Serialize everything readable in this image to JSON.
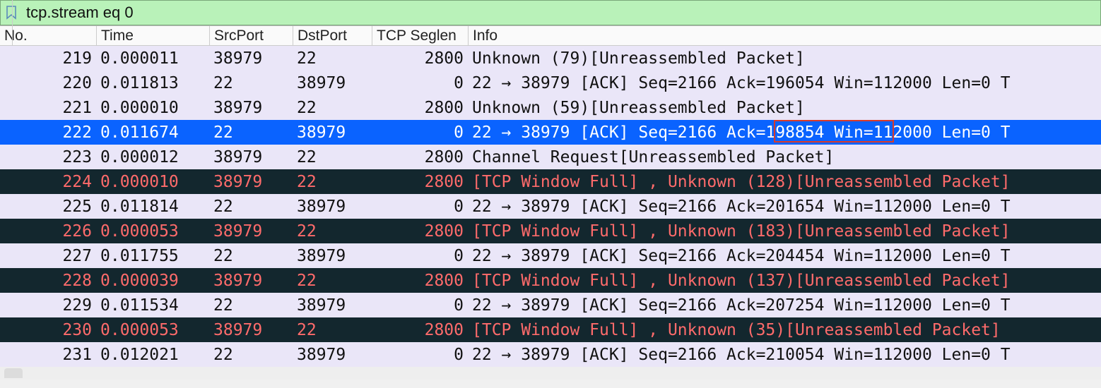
{
  "filter": {
    "value": "tcp.stream eq 0"
  },
  "columns": {
    "no": "No.",
    "time": "Time",
    "src": "SrcPort",
    "dst": "DstPort",
    "seg": "TCP Seglen",
    "info": "Info"
  },
  "rows": [
    {
      "no": "219",
      "time": "0.000011",
      "src": "38979",
      "dst": "22",
      "seg": "2800",
      "info": "Unknown (79)[Unreassembled Packet]",
      "theme": "ssh"
    },
    {
      "no": "220",
      "time": "0.011813",
      "src": "22",
      "dst": "38979",
      "seg": "0",
      "info": "22 → 38979 [ACK] Seq=2166 Ack=196054 Win=112000 Len=0 T",
      "theme": "ssh"
    },
    {
      "no": "221",
      "time": "0.000010",
      "src": "38979",
      "dst": "22",
      "seg": "2800",
      "info": "Unknown (59)[Unreassembled Packet]",
      "theme": "ssh"
    },
    {
      "no": "222",
      "time": "0.011674",
      "src": "22",
      "dst": "38979",
      "seg": "0",
      "info": "22 → 38979 [ACK] Seq=2166 Ack=198854 Win=112000 Len=0 T",
      "theme": "sel",
      "highlight": true,
      "highlight_text": "Ack=198854"
    },
    {
      "no": "223",
      "time": "0.000012",
      "src": "38979",
      "dst": "22",
      "seg": "2800",
      "info": "Channel Request[Unreassembled Packet]",
      "theme": "ssh"
    },
    {
      "no": "224",
      "time": "0.000010",
      "src": "38979",
      "dst": "22",
      "seg": "2800",
      "info": "[TCP Window Full] , Unknown (128)[Unreassembled Packet]",
      "theme": "badtcp"
    },
    {
      "no": "225",
      "time": "0.011814",
      "src": "22",
      "dst": "38979",
      "seg": "0",
      "info": "22 → 38979 [ACK] Seq=2166 Ack=201654 Win=112000 Len=0 T",
      "theme": "ssh"
    },
    {
      "no": "226",
      "time": "0.000053",
      "src": "38979",
      "dst": "22",
      "seg": "2800",
      "info": "[TCP Window Full] , Unknown (183)[Unreassembled Packet]",
      "theme": "badtcp"
    },
    {
      "no": "227",
      "time": "0.011755",
      "src": "22",
      "dst": "38979",
      "seg": "0",
      "info": "22 → 38979 [ACK] Seq=2166 Ack=204454 Win=112000 Len=0 T",
      "theme": "ssh"
    },
    {
      "no": "228",
      "time": "0.000039",
      "src": "38979",
      "dst": "22",
      "seg": "2800",
      "info": "[TCP Window Full] , Unknown (137)[Unreassembled Packet]",
      "theme": "badtcp"
    },
    {
      "no": "229",
      "time": "0.011534",
      "src": "22",
      "dst": "38979",
      "seg": "0",
      "info": "22 → 38979 [ACK] Seq=2166 Ack=207254 Win=112000 Len=0 T",
      "theme": "ssh"
    },
    {
      "no": "230",
      "time": "0.000053",
      "src": "38979",
      "dst": "22",
      "seg": "2800",
      "info": "[TCP Window Full] , Unknown (35)[Unreassembled Packet]",
      "theme": "badtcp"
    },
    {
      "no": "231",
      "time": "0.012021",
      "src": "22",
      "dst": "38979",
      "seg": "0",
      "info": "22 → 38979 [ACK] Seq=2166 Ack=210054 Win=112000 Len=0 T",
      "theme": "ssh"
    }
  ]
}
